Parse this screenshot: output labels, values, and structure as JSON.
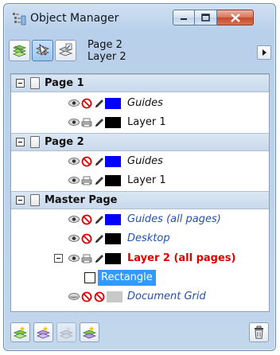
{
  "window": {
    "title": "Object Manager"
  },
  "toolbar": {
    "page_name": "Page 2",
    "layer_name": "Layer 2",
    "buttons": [
      {
        "icon": "show-object-properties-icon",
        "active": false
      },
      {
        "icon": "edit-across-layers-icon",
        "active": true
      },
      {
        "icon": "layer-manager-view-icon",
        "active": false
      }
    ],
    "menu_arrow": "flyout-arrow-icon"
  },
  "tree": {
    "pages": [
      {
        "name": "Page 1",
        "layers": [
          {
            "name": "Guides",
            "style": "italic",
            "print": "disabled",
            "color": "#0000ff"
          },
          {
            "name": "Layer 1",
            "style": "normal",
            "print": "enabled",
            "color": "#000000"
          }
        ]
      },
      {
        "name": "Page 2",
        "layers": [
          {
            "name": "Guides",
            "style": "italic",
            "print": "disabled",
            "color": "#0000ff"
          },
          {
            "name": "Layer 1",
            "style": "normal",
            "print": "enabled",
            "color": "#000000"
          }
        ]
      },
      {
        "name": "Master Page",
        "layers": [
          {
            "name": "Guides (all pages)",
            "style": "italic-blue",
            "print": "disabled",
            "color": "#0000ff"
          },
          {
            "name": "Desktop",
            "style": "italic-blue",
            "print": "disabled",
            "color": "#000000"
          },
          {
            "name": "Layer 2 (all pages)",
            "style": "bold-red",
            "print": "enabled",
            "color": "#000000",
            "expanded": true,
            "objects": [
              {
                "name": "Rectangle",
                "selected": true
              }
            ]
          },
          {
            "name": "Document Grid",
            "style": "italic-blue",
            "print": "disabled",
            "edit": "disabled",
            "color": "#c8c8c8"
          }
        ]
      }
    ]
  },
  "bottombar": {
    "buttons": [
      {
        "icon": "new-layer-icon",
        "enabled": true
      },
      {
        "icon": "new-master-layer-icon",
        "enabled": true
      },
      {
        "icon": "new-master-layer-odd-icon",
        "enabled": false
      },
      {
        "icon": "new-master-layer-even-icon",
        "enabled": true
      }
    ],
    "delete_icon": "trash-icon"
  },
  "colors": {
    "selection": "#3399ff",
    "active_layer": "#e00000",
    "master_layer_text": "#2451b0"
  }
}
